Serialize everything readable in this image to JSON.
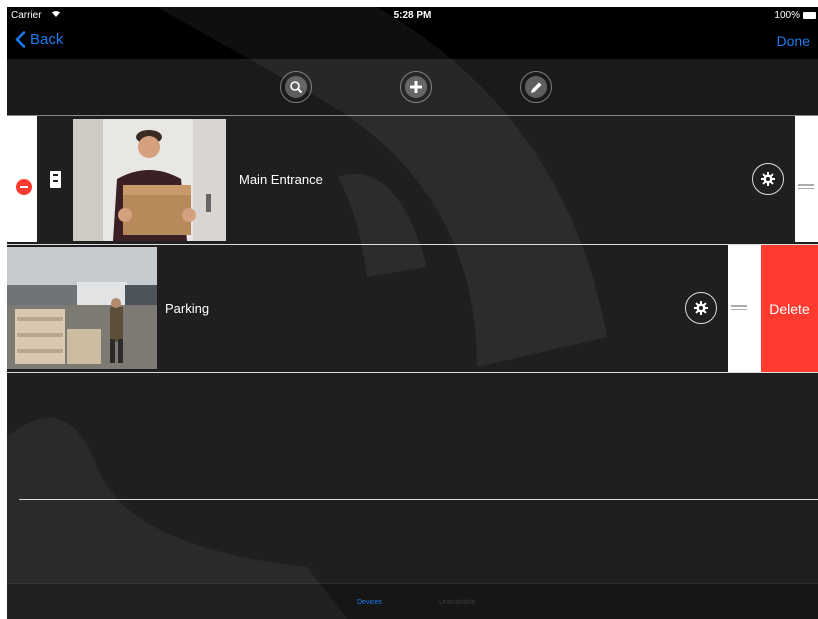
{
  "status_bar": {
    "carrier": "Carrier",
    "time": "5:28 PM",
    "battery": "100%"
  },
  "nav_bar": {
    "back_label": "Back",
    "done_label": "Done"
  },
  "toolbar": {
    "icons": [
      "search-icon",
      "add-icon",
      "edit-icon"
    ]
  },
  "devices": [
    {
      "name": "Main Entrance",
      "editing": true
    },
    {
      "name": "Parking",
      "swiped_delete": true
    }
  ],
  "delete_label": "Delete",
  "tabs": [
    {
      "label": "Devices",
      "selected": true
    },
    {
      "label": "Unavailable",
      "selected": false
    }
  ],
  "colors": {
    "accent": "#1a7cf0",
    "delete": "#ff3b30",
    "background": "#1f1f1f"
  }
}
